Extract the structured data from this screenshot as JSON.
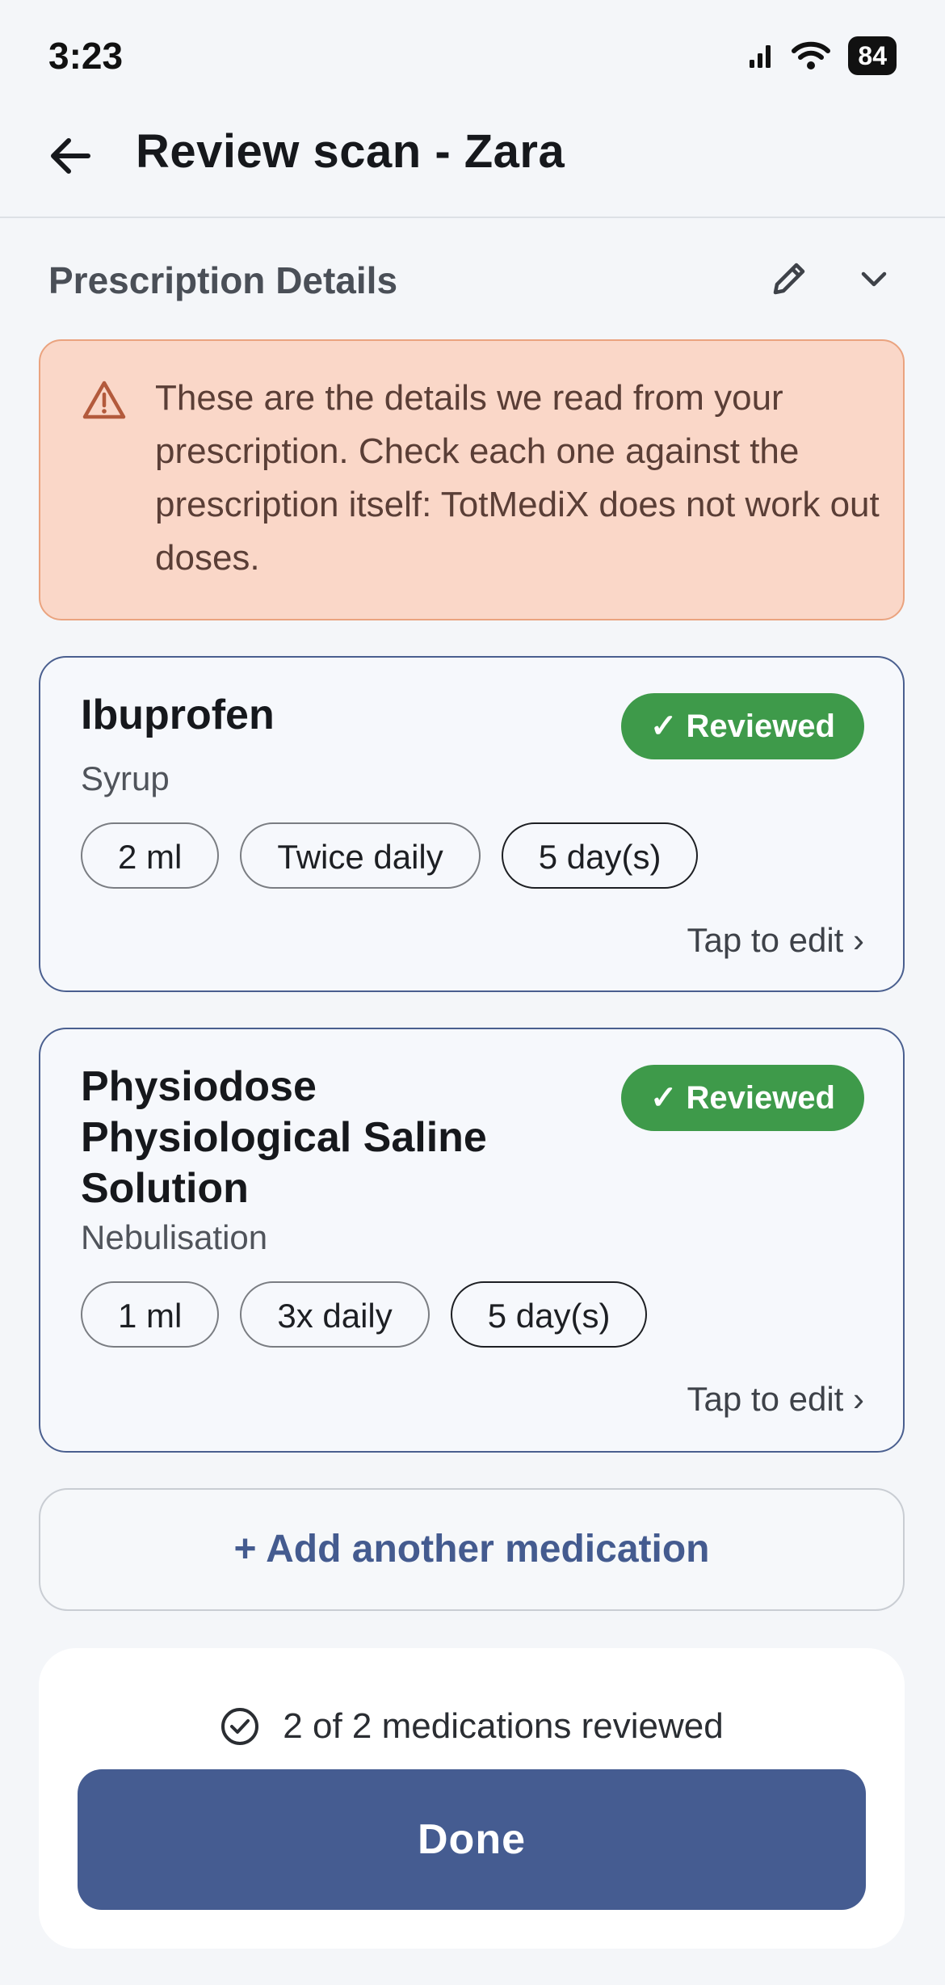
{
  "status_bar": {
    "time": "3:23",
    "battery": "84"
  },
  "header": {
    "title": "Review scan - Zara"
  },
  "section": {
    "title": "Prescription Details"
  },
  "warning": {
    "text": "These are the details we read from your prescription. Check each one against the prescription itself: TotMediX does not work out doses."
  },
  "medications": [
    {
      "name": "Ibuprofen",
      "form": "Syrup",
      "status": "✓ Reviewed",
      "dose": "2 ml",
      "frequency": "Twice daily",
      "duration": "5 day(s)",
      "edit_label": "Tap to edit ›"
    },
    {
      "name": "Physiodose Physiological Saline Solution",
      "form": "Nebulisation",
      "status": "✓ Reviewed",
      "dose": "1 ml",
      "frequency": "3x daily",
      "duration": "5 day(s)",
      "edit_label": "Tap to edit ›"
    }
  ],
  "add_button": {
    "label": "+ Add another medication"
  },
  "footer": {
    "review_status": "2 of 2 medications reviewed",
    "done_label": "Done"
  },
  "colors": {
    "accent": "#455c91",
    "reviewed_badge": "#3e9a4a",
    "warning_bg": "#fad7c8",
    "warning_border": "#eaa37f"
  },
  "icons": [
    "signal-icon",
    "wifi-icon",
    "back-arrow-icon",
    "pencil-icon",
    "chevron-down-icon",
    "warning-triangle-icon",
    "check-circle-icon"
  ]
}
